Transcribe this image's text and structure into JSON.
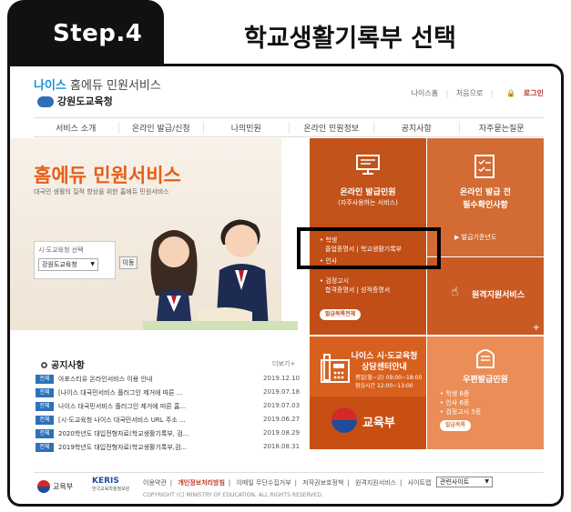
{
  "step": {
    "label": "Step.4",
    "title": "학교생활기록부 선택"
  },
  "header": {
    "brand_neis": "나이스",
    "brand_rest": " 홈에듀 민원서비스",
    "office": "강원도교육청",
    "topnav": {
      "home": "나이스홈",
      "first": "처음으로",
      "login": "로그인"
    }
  },
  "menu": [
    "서비스 소개",
    "온라인 발급/신청",
    "나의민원",
    "온라인 민원정보",
    "공지사항",
    "자주묻는질문"
  ],
  "hero": {
    "title": "홈에듀 민원서비스",
    "subtitle": "대국민 생활의 질적 향상을 위한 홈에듀 민원서비스",
    "select_label": "시·도교육청 선택",
    "select_value": "강원도교육청",
    "move_button": "이동"
  },
  "tiles": {
    "online_issue": {
      "title": "온라인 발급민원",
      "subtitle": "(자주사용하는 서비스)",
      "student_label": "학생",
      "student_items": "졸업증명서 | 학교생활기록부",
      "personnel": "인사",
      "exam_label": "검정고시",
      "exam_items": "합격증명서 | 성적증명서",
      "button": "발급목록전체"
    },
    "check": {
      "title1": "온라인 발급 전",
      "title2": "필수확인사항",
      "link": "발급기준년도"
    },
    "remote": {
      "title": "원격지원서비스"
    },
    "center": {
      "title1": "나이스 시·도교육청",
      "title2": "상담센터안내",
      "hours1": "평일(월~금) 09:00~18:00",
      "hours2": "점심시간 12:00~13:00",
      "ministry": "교육부"
    },
    "postal": {
      "title": "우편발급민원",
      "item1": "학생 6종",
      "item2": "인사 6종",
      "item3": "검정고시 5종",
      "button": "발급목록"
    }
  },
  "notices": {
    "title": "공지사항",
    "more": "더보기+",
    "items": [
      {
        "tag": "전체",
        "text": "아포스티유 온라인서비스 이용 안내",
        "date": "2019.12.10"
      },
      {
        "tag": "전체",
        "text": "[나이스 대국민서비스 플러그인 제거에 따른 ...",
        "date": "2019.07.18"
      },
      {
        "tag": "전체",
        "text": "나이스 대국민서비스 플러그인 제거에 따른 홈...",
        "date": "2019.07.03"
      },
      {
        "tag": "전체",
        "text": "[시·도교육청 나이스 대국민서비스 URL 주소 ...",
        "date": "2019.06.27"
      },
      {
        "tag": "전체",
        "text": "2020학년도 대입전형자료(학교생활기록부, 검...",
        "date": "2019.08.29"
      },
      {
        "tag": "전체",
        "text": "2019학년도 대입전형자료(학교생활기록부,검...",
        "date": "2018.08.31"
      }
    ]
  },
  "footer": {
    "ministry": "교육부",
    "keris": "KERIS",
    "keris_sub": "한국교육학술정보원",
    "links": [
      "이용약관",
      "개인정보처리방침",
      "이메일 무단수집거부",
      "저작권보호정책",
      "원격지원서비스",
      "사이트맵"
    ],
    "copyright": "COPYRIGHT (C) MINISTRY OF EDUCATION. ALL RIGHTS RESERVED.",
    "related": "관련사이트"
  }
}
